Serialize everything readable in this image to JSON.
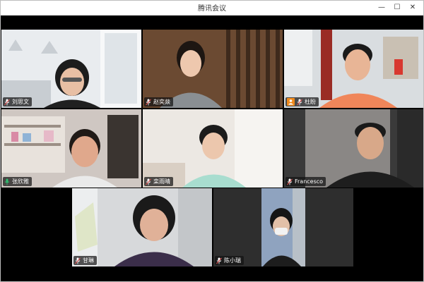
{
  "window": {
    "title": "腾讯会议",
    "controls": {
      "minimize": "—",
      "maximize": "☐",
      "close": "✕"
    }
  },
  "colors": {
    "stage_bg": "#000000",
    "active_speaker_border": "#2fbf71",
    "mic_muted": "#e25555",
    "mic_speaking": "#2fbf71",
    "host_badge": "#f08a1c"
  },
  "participants": [
    {
      "name": "刘思文",
      "mic": "muted",
      "host": false,
      "active": false
    },
    {
      "name": "赵奕燚",
      "mic": "muted",
      "host": false,
      "active": false
    },
    {
      "name": "杜盼",
      "mic": "muted",
      "host": true,
      "active": false
    },
    {
      "name": "张欣雅",
      "mic": "speaking",
      "host": false,
      "active": true
    },
    {
      "name": "栾雨晴",
      "mic": "muted",
      "host": false,
      "active": false
    },
    {
      "name": "Francesco",
      "mic": "muted",
      "host": false,
      "active": false
    },
    {
      "name": "甘琳",
      "mic": "muted",
      "host": false,
      "active": false
    },
    {
      "name": "陈小瑞",
      "mic": "muted",
      "host": false,
      "active": false
    }
  ]
}
